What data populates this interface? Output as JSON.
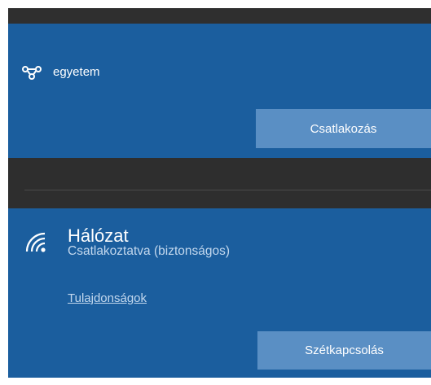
{
  "networks": [
    {
      "name": "egyetem",
      "icon": "network-hub-icon",
      "action_label": "Csatlakozás"
    },
    {
      "name": "Hálózat",
      "icon": "wifi-signal-icon",
      "status": "Csatlakoztatva (biztonságos)",
      "properties_link": "Tulajdonságok",
      "action_label": "Szétkapcsolás"
    }
  ],
  "colors": {
    "panel_blue": "#1b5e9e",
    "button_blue": "#5a8fc4",
    "dark_background": "#2e2e2e",
    "secondary_text": "#c3d8ee"
  }
}
